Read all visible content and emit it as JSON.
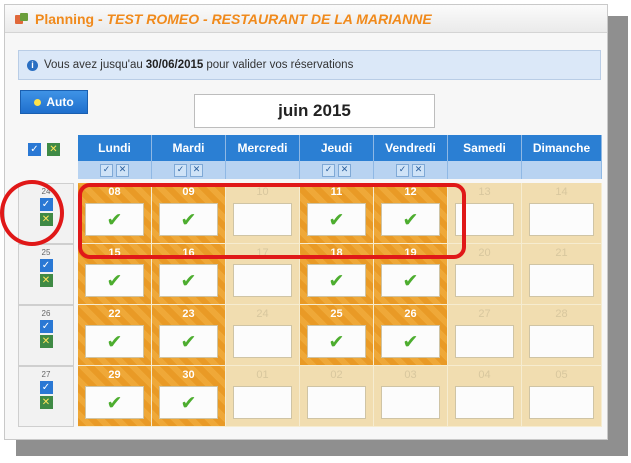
{
  "window": {
    "title_prefix": "Planning - ",
    "title_italic": "TEST ROMEO - RESTAURANT DE LA MARIANNE"
  },
  "info": {
    "icon": "info-icon",
    "text_before": "Vous avez jusqu'au",
    "date": "30/06/2015",
    "text_after": "pour valider vos réservations"
  },
  "auto_button": {
    "label": "Auto"
  },
  "month_label": "juin 2015",
  "days": [
    "Lundi",
    "Mardi",
    "Mercredi",
    "Jeudi",
    "Vendredi",
    "Samedi",
    "Dimanche"
  ],
  "select_icons": {
    "check": "✓",
    "uncheck": "✕"
  },
  "weeks": [
    {
      "number": "24",
      "days": [
        {
          "d": "08",
          "on": true,
          "checked": true
        },
        {
          "d": "09",
          "on": true,
          "checked": true
        },
        {
          "d": "10",
          "on": false,
          "checked": false
        },
        {
          "d": "11",
          "on": true,
          "checked": true
        },
        {
          "d": "12",
          "on": true,
          "checked": true
        },
        {
          "d": "13",
          "on": false,
          "checked": false
        },
        {
          "d": "14",
          "on": false,
          "checked": false
        }
      ]
    },
    {
      "number": "25",
      "days": [
        {
          "d": "15",
          "on": true,
          "checked": true
        },
        {
          "d": "16",
          "on": true,
          "checked": true
        },
        {
          "d": "17",
          "on": false,
          "checked": false
        },
        {
          "d": "18",
          "on": true,
          "checked": true
        },
        {
          "d": "19",
          "on": true,
          "checked": true
        },
        {
          "d": "20",
          "on": false,
          "checked": false
        },
        {
          "d": "21",
          "on": false,
          "checked": false
        }
      ]
    },
    {
      "number": "26",
      "days": [
        {
          "d": "22",
          "on": true,
          "checked": true
        },
        {
          "d": "23",
          "on": true,
          "checked": true
        },
        {
          "d": "24",
          "on": false,
          "checked": false
        },
        {
          "d": "25",
          "on": true,
          "checked": true
        },
        {
          "d": "26",
          "on": true,
          "checked": true
        },
        {
          "d": "27",
          "on": false,
          "checked": false
        },
        {
          "d": "28",
          "on": false,
          "checked": false
        }
      ]
    },
    {
      "number": "27",
      "days": [
        {
          "d": "29",
          "on": true,
          "checked": true
        },
        {
          "d": "30",
          "on": true,
          "checked": true
        },
        {
          "d": "01",
          "on": false,
          "checked": false
        },
        {
          "d": "02",
          "on": false,
          "checked": false
        },
        {
          "d": "03",
          "on": false,
          "checked": false
        },
        {
          "d": "04",
          "on": false,
          "checked": false
        },
        {
          "d": "05",
          "on": false,
          "checked": false
        }
      ]
    }
  ],
  "day_select_visible": [
    true,
    true,
    false,
    true,
    true,
    false,
    false
  ],
  "colors": {
    "accent_orange": "#e99a26",
    "header_blue": "#2b7fd3",
    "check_green": "#4dad2f",
    "highlight_red": "#e01818"
  }
}
